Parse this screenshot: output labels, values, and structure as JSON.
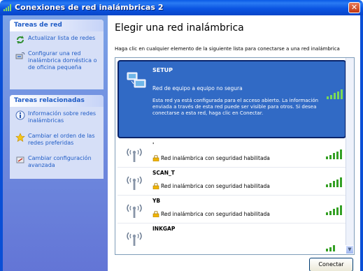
{
  "window": {
    "title": "Conexiones de red inalámbricas 2",
    "close_label": "✕"
  },
  "sidebar": {
    "network_tasks": {
      "heading": "Tareas de red",
      "items": [
        {
          "label": "Actualizar lista de redes",
          "icon": "refresh-icon"
        },
        {
          "label": "Configurar una red inalámbrica doméstica o de oficina pequeña",
          "icon": "wireless-setup-icon"
        }
      ]
    },
    "related_tasks": {
      "heading": "Tareas relacionadas",
      "items": [
        {
          "label": "Información sobre redes inalámbricas",
          "icon": "info-icon"
        },
        {
          "label": "Cambiar el orden de las redes preferidas",
          "icon": "star-icon"
        },
        {
          "label": "Cambiar configuración avanzada",
          "icon": "settings-icon"
        }
      ]
    }
  },
  "main": {
    "title": "Elegir una red inalámbrica",
    "description": "Haga clic en cualquier elemento de la siguiente lista para conectarse a una red inalámbrica"
  },
  "networks": [
    {
      "name": "SETUP",
      "status": "Red de equipo a equipo no segura",
      "details": "Esta red ya está configurada para el acceso abierto. La información enviada a través de esta red puede ser visible para otros. Si desea conectarse a esta red, haga clic en Conectar.",
      "selected": true,
      "signal_bars": 5
    },
    {
      "name": "'",
      "status": "Red inalámbrica con seguridad habilitada",
      "signal_bars": 5
    },
    {
      "name": "SCAN_T",
      "status": "Red inalámbrica con seguridad habilitada",
      "signal_bars": 5
    },
    {
      "name": "YB",
      "status": "Red inalámbrica con seguridad habilitada",
      "signal_bars": 5
    },
    {
      "name": "INKGAP",
      "status": "",
      "signal_bars": 3
    }
  ],
  "buttons": {
    "connect": "Conectar"
  },
  "colors": {
    "titlebar": "#0b55e3",
    "selection": "#316ac5",
    "signal_green": "#34a024",
    "link": "#215dc6"
  }
}
